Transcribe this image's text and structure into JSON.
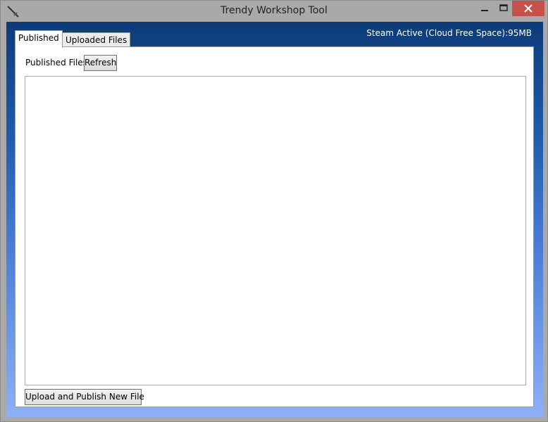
{
  "window": {
    "title": "Trendy Workshop Tool"
  },
  "status": {
    "text": "Steam Active (Cloud Free Space):95MB"
  },
  "tabs": [
    {
      "label": "Published",
      "selected": true
    },
    {
      "label": "Uploaded Files",
      "selected": false
    }
  ],
  "published_tab": {
    "label": "Published Files",
    "refresh_label": "Refresh",
    "files": [],
    "upload_label": "Upload and Publish New File"
  },
  "icons": {
    "app": "sword-icon",
    "minimize": "minimize-icon",
    "maximize": "maximize-icon",
    "close": "close-icon"
  },
  "colors": {
    "close_button": "#c7504a",
    "gradient_top": "#0d3b78",
    "gradient_bottom": "#8fb0f7"
  }
}
